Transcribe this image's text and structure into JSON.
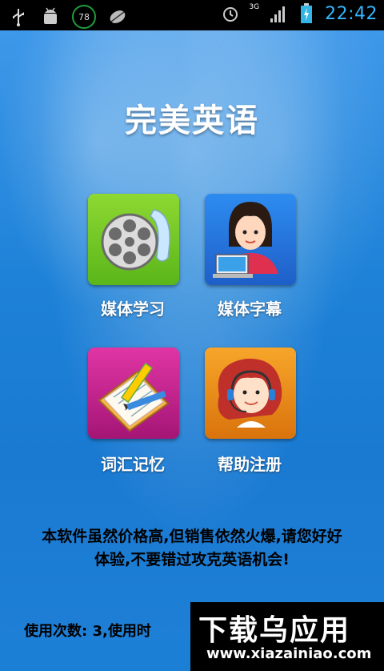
{
  "status_bar": {
    "battery_level": "78",
    "network_type": "3G",
    "time": "22:42",
    "icons": [
      "usb-icon",
      "android-debug-icon",
      "battery-status-icon",
      "leaf-app-icon",
      "alarm-icon",
      "signal-icon",
      "battery-charging-icon"
    ]
  },
  "app": {
    "title": "完美英语"
  },
  "menu": [
    {
      "label": "媒体学习",
      "icon": "film-reel-icon",
      "color": "#6cc324"
    },
    {
      "label": "媒体字幕",
      "icon": "student-at-computer-icon",
      "color": "#2573db"
    },
    {
      "label": "词汇记忆",
      "icon": "notebook-pencil-icon",
      "color": "#c0238a"
    },
    {
      "label": "帮助注册",
      "icon": "support-agent-icon",
      "color": "#ea8a1a"
    }
  ],
  "notice": {
    "line1": "本软件虽然价格高,但销售依然火爆,请您好好",
    "line2": "体验,不要错过攻克英语机会!"
  },
  "usage": {
    "text": "使用次数: 3,使用时"
  },
  "watermark": {
    "brand": "下载乌应用",
    "url": "www.xiazainiao.com"
  }
}
